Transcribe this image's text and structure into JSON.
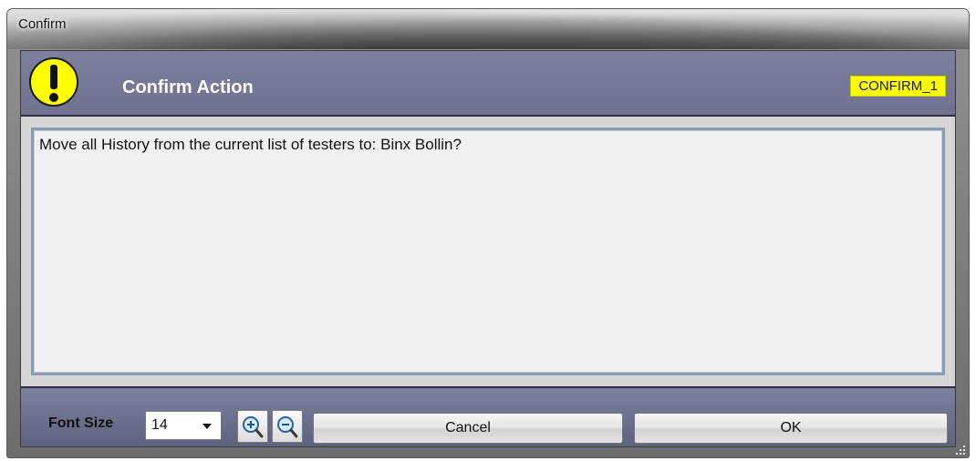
{
  "window": {
    "title": "Confirm"
  },
  "header": {
    "title": "Confirm Action",
    "code": "CONFIRM_1",
    "icon": "warning-icon",
    "colors": {
      "band": "#7d7f9e",
      "badge": "#ffff00",
      "icon": "#ffff00"
    }
  },
  "message": {
    "text": "Move all History from the current list of testers to:  Binx Bollin?"
  },
  "footer": {
    "font_size_label": "Font Size",
    "font_size_value": "14",
    "zoom_in_icon": "zoom-in-icon",
    "zoom_out_icon": "zoom-out-icon",
    "cancel_label": "Cancel",
    "ok_label": "OK"
  }
}
